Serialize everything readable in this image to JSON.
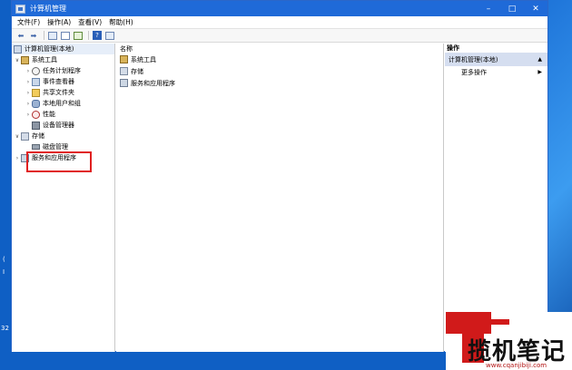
{
  "window": {
    "title": "计算机管理"
  },
  "controls": {
    "minimize": "–",
    "maximize": "□",
    "close": "✕"
  },
  "menu": [
    "文件(F)",
    "操作(A)",
    "查看(V)",
    "帮助(H)"
  ],
  "tree": {
    "root": "计算机管理(本地)",
    "system_tools": "系统工具",
    "task_scheduler": "任务计划程序",
    "event_viewer": "事件查看器",
    "shared_folders": "共享文件夹",
    "local_users": "本地用户和组",
    "performance": "性能",
    "device_manager": "设备管理器",
    "storage": "存储",
    "disk_management": "磁盘管理",
    "services_apps": "服务和应用程序"
  },
  "list": {
    "header": "名称",
    "rows": [
      "系统工具",
      "存储",
      "服务和应用程序"
    ]
  },
  "actions": {
    "header": "操作",
    "group": "计算机管理(本地)",
    "more": "更多操作"
  },
  "watermark": {
    "text": "揽机笔记",
    "url": "www.cqanjibiji.com"
  },
  "desktop_glyphs": [
    "(",
    "I",
    "32"
  ]
}
